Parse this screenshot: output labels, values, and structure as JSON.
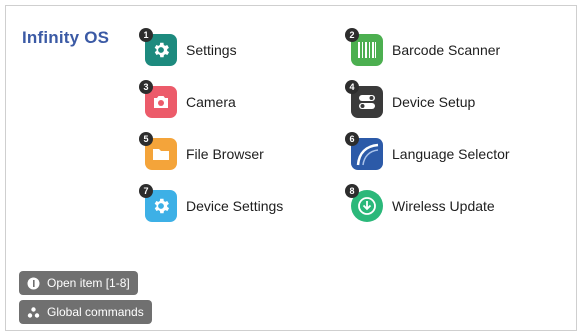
{
  "brand": {
    "title": "Infinity OS"
  },
  "apps": [
    {
      "num": "1",
      "label": "Settings",
      "icon": "gear-icon",
      "color": "#1d8a7e"
    },
    {
      "num": "2",
      "label": "Barcode Scanner",
      "icon": "barcode-icon",
      "color": "#4caf50"
    },
    {
      "num": "3",
      "label": "Camera",
      "icon": "camera-icon",
      "color": "#ec5b6a"
    },
    {
      "num": "4",
      "label": "Device Setup",
      "icon": "toggle-switch-icon",
      "color": "#3a3a3a"
    },
    {
      "num": "5",
      "label": "File Browser",
      "icon": "folder-icon",
      "color": "#f4a43a"
    },
    {
      "num": "6",
      "label": "Language Selector",
      "icon": "globe-arc-icon",
      "color": "#2c5aa8"
    },
    {
      "num": "7",
      "label": "Device Settings",
      "icon": "gear-icon",
      "color": "#3db0e6"
    },
    {
      "num": "8",
      "label": "Wireless Update",
      "icon": "download-circle-icon",
      "color": "#2bb87a"
    }
  ],
  "footer": {
    "open_item": "Open item [1-8]",
    "global_commands": "Global commands"
  }
}
